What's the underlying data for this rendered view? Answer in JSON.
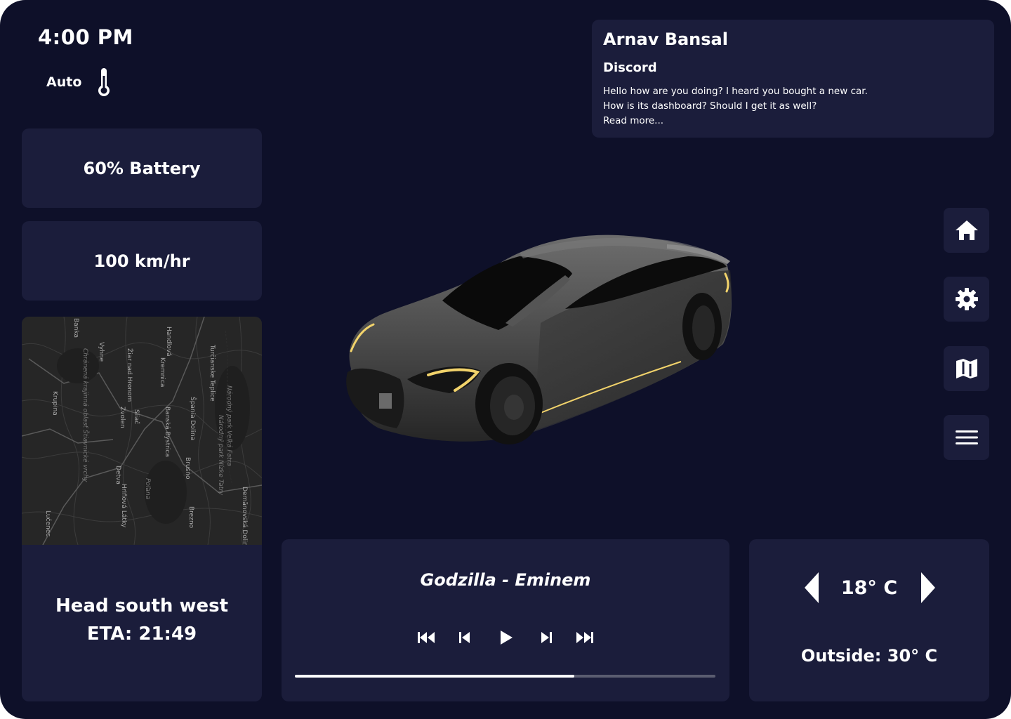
{
  "status": {
    "time": "4:00 PM",
    "climate_mode": "Auto",
    "thermometer_icon": "thermometer-icon"
  },
  "battery": {
    "label": "60% Battery",
    "percent": 60
  },
  "speed": {
    "label": "100 km/hr"
  },
  "map": {
    "labels": [
      "Banská Bystrica",
      "Zvolen",
      "Krupina",
      "Detva",
      "Brezno",
      "Lučenec",
      "Handlová",
      "Kremnica",
      "Žiar nad Hronom",
      "Turčianske Teplice",
      "Vyhne",
      "Sliač",
      "Brusno",
      "Hriňová Látky",
      "Špania Dolina",
      "Banka",
      "Národný park Veľká Fatra",
      "Národný park Nízke Tatry",
      "Poľana",
      "Demänovská Dolina",
      "Chránená krajinná oblasť Štiavnické vrchy"
    ],
    "navigation_line1": "Head south west",
    "navigation_line2": "ETA: 21:49"
  },
  "message": {
    "sender": "Arnav Bansal",
    "app": "Discord",
    "line1": "Hello how are you doing? I heard you bought a new car.",
    "line2": "How is its dashboard? Should I get it as well?",
    "read_more": "Read more..."
  },
  "side_nav": [
    "home-icon",
    "settings-icon",
    "map-icon",
    "menu-icon"
  ],
  "music": {
    "song": "Godzilla - Eminem",
    "progress": 0.665,
    "controls": [
      "skip-to-start-icon",
      "previous-icon",
      "play-icon",
      "next-icon",
      "skip-to-end-icon"
    ]
  },
  "climate": {
    "temperature": "18° C",
    "outside": "Outside: 30° C"
  },
  "colors": {
    "background": "#0e1029",
    "card": "#1b1d3b",
    "text": "#ffffff",
    "headlight": "#f2d36b"
  }
}
